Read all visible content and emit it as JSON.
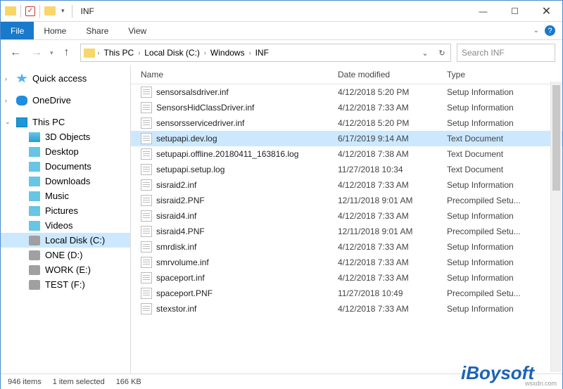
{
  "window": {
    "title": "INF"
  },
  "ribbon": {
    "file": "File",
    "home": "Home",
    "share": "Share",
    "view": "View"
  },
  "breadcrumb": {
    "items": [
      "This PC",
      "Local Disk (C:)",
      "Windows",
      "INF"
    ]
  },
  "search": {
    "placeholder": "Search INF"
  },
  "sidebar": {
    "quick": "Quick access",
    "onedrive": "OneDrive",
    "thispc": "This PC",
    "subs": [
      "3D Objects",
      "Desktop",
      "Documents",
      "Downloads",
      "Music",
      "Pictures",
      "Videos",
      "Local Disk (C:)",
      "ONE (D:)",
      "WORK (E:)",
      "TEST (F:)"
    ]
  },
  "columns": {
    "name": "Name",
    "date": "Date modified",
    "type": "Type"
  },
  "files": [
    {
      "name": "sensorsalsdriver.inf",
      "date": "4/12/2018 5:20 PM",
      "type": "Setup Information",
      "sel": false
    },
    {
      "name": "SensorsHidClassDriver.inf",
      "date": "4/12/2018 7:33 AM",
      "type": "Setup Information",
      "sel": false
    },
    {
      "name": "sensorsservicedriver.inf",
      "date": "4/12/2018 5:20 PM",
      "type": "Setup Information",
      "sel": false
    },
    {
      "name": "setupapi.dev.log",
      "date": "6/17/2019 9:14 AM",
      "type": "Text Document",
      "sel": true
    },
    {
      "name": "setupapi.offline.20180411_163816.log",
      "date": "4/12/2018 7:38 AM",
      "type": "Text Document",
      "sel": false
    },
    {
      "name": "setupapi.setup.log",
      "date": "11/27/2018 10:34",
      "type": "Text Document",
      "sel": false
    },
    {
      "name": "sisraid2.inf",
      "date": "4/12/2018 7:33 AM",
      "type": "Setup Information",
      "sel": false
    },
    {
      "name": "sisraid2.PNF",
      "date": "12/11/2018 9:01 AM",
      "type": "Precompiled Setu...",
      "sel": false
    },
    {
      "name": "sisraid4.inf",
      "date": "4/12/2018 7:33 AM",
      "type": "Setup Information",
      "sel": false
    },
    {
      "name": "sisraid4.PNF",
      "date": "12/11/2018 9:01 AM",
      "type": "Precompiled Setu...",
      "sel": false
    },
    {
      "name": "smrdisk.inf",
      "date": "4/12/2018 7:33 AM",
      "type": "Setup Information",
      "sel": false
    },
    {
      "name": "smrvolume.inf",
      "date": "4/12/2018 7:33 AM",
      "type": "Setup Information",
      "sel": false
    },
    {
      "name": "spaceport.inf",
      "date": "4/12/2018 7:33 AM",
      "type": "Setup Information",
      "sel": false
    },
    {
      "name": "spaceport.PNF",
      "date": "11/27/2018 10:49",
      "type": "Precompiled Setu...",
      "sel": false
    },
    {
      "name": "stexstor.inf",
      "date": "4/12/2018 7:33 AM",
      "type": "Setup Information",
      "sel": false
    }
  ],
  "status": {
    "count": "946 items",
    "selected": "1 item selected",
    "size": "166 KB"
  },
  "branding": {
    "logo": "iBoysoft",
    "watermark": "wsxdn.com"
  }
}
